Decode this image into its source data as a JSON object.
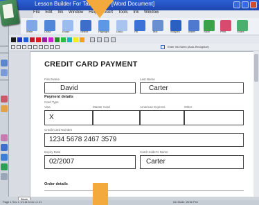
{
  "window": {
    "title": "Lesson Builder For Tablet PC - [Word Document]"
  },
  "menu": [
    "File",
    "Edit",
    "Ink",
    "Window",
    "Help",
    "Insert",
    "Tools",
    "Ink",
    "Window"
  ],
  "toolbar_labels": [
    "Write",
    "Draw",
    "Erase",
    "Select",
    "Highlight",
    "Undo",
    "Fill",
    "Text",
    "Shapes",
    "Insert",
    "Save",
    "Print",
    "Share"
  ],
  "toolbar3": {
    "hint": "Enter Ink Notes (Auto-Recognize)"
  },
  "colors": {
    "swatches": [
      "#1a1a1a",
      "#1e2fbf",
      "#1a5fd6",
      "#c0182a",
      "#e01b1b",
      "#9b1aa8",
      "#d01fcf",
      "#2a8d2a",
      "#23c13c",
      "#12b7c2",
      "#f2ee1e",
      "#f39e1e"
    ],
    "accent_arrow": "#f3a93b"
  },
  "form": {
    "title": "CREDIT CARD PAYMENT",
    "first_name_label": "First Name",
    "first_name": "David",
    "last_name_label": "Last Name",
    "last_name": "Carter",
    "payment_details": "Payment details",
    "card_type_label": "Card Type",
    "card_options": [
      "Visa",
      "Master Card",
      "American Express",
      "Other"
    ],
    "card_selected": "X",
    "card_number_label": "Credit Card Number",
    "card_number": "1234 5678 2467 3579",
    "expiry_label": "Expiry Date",
    "expiry": "02/2007",
    "holder_label": "Card Holder's Name",
    "holder": "Carter",
    "order_details": "Order details"
  },
  "tab": "Blank",
  "status": {
    "left": "Page 1 Sec 1 1/1 At 6.1in Ln 21",
    "right": "Ink Mode: Write Pen"
  }
}
